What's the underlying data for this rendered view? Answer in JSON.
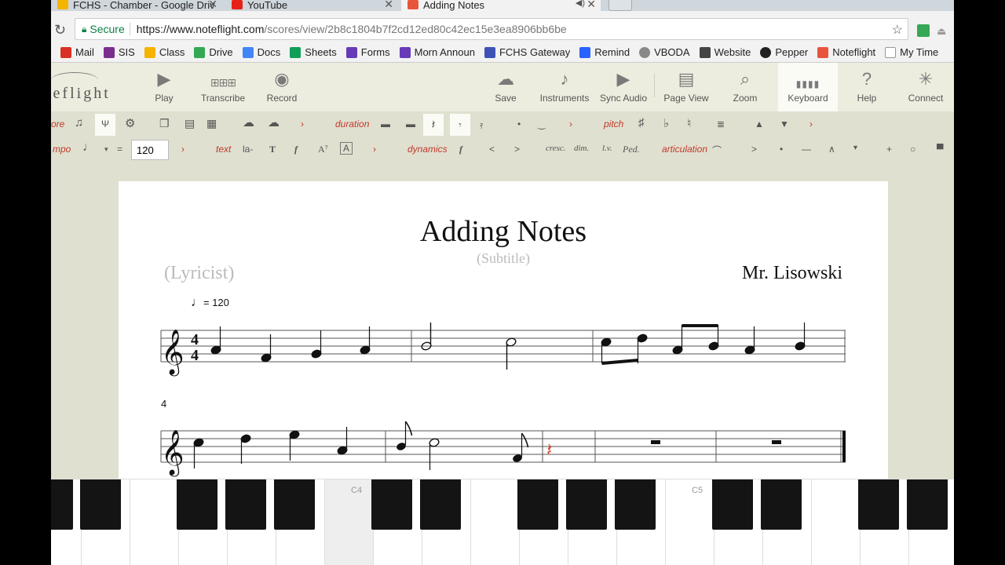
{
  "tabs": [
    {
      "title": "FCHS - Chamber - Google Driv",
      "color": "#f4b400"
    },
    {
      "title": "YouTube",
      "color": "#e62117"
    },
    {
      "title": "Adding Notes",
      "color": "#e8553d"
    }
  ],
  "omnibox": {
    "secure_label": "Secure",
    "url_host": "https://www.noteflight.com",
    "url_path": "/scores/view/2b8c1804b7f2cd12ed80c42ec15e3ea8906bb6be"
  },
  "bookmarks": [
    {
      "label": "Mail",
      "color": "#d93025"
    },
    {
      "label": "SIS",
      "color": "#7b2d8e"
    },
    {
      "label": "Class",
      "color": "#f4b400"
    },
    {
      "label": "Drive",
      "color": "#34a853"
    },
    {
      "label": "Docs",
      "color": "#4285f4"
    },
    {
      "label": "Sheets",
      "color": "#0f9d58"
    },
    {
      "label": "Forms",
      "color": "#673ab7"
    },
    {
      "label": "Morn Announ",
      "color": "#673ab7"
    },
    {
      "label": "FCHS Gateway",
      "color": "#3f51b5"
    },
    {
      "label": "Remind",
      "color": "#2962ff"
    },
    {
      "label": "VBODA",
      "color": "#888888"
    },
    {
      "label": "Website",
      "color": "#444444"
    },
    {
      "label": "Pepper",
      "color": "#222222"
    },
    {
      "label": "Noteflight",
      "color": "#e8553d"
    },
    {
      "label": "My Time",
      "color": "#aaaaaa"
    }
  ],
  "app": {
    "logo": "teflight",
    "toolbar": {
      "play": "Play",
      "transcribe": "Transcribe",
      "record": "Record",
      "save": "Save",
      "instruments": "Instruments",
      "sync_audio": "Sync Audio",
      "page_view": "Page View",
      "zoom": "Zoom",
      "keyboard": "Keyboard",
      "help": "Help",
      "connect": "Connect"
    },
    "palette": {
      "score_label": "ore",
      "duration_label": "duration",
      "pitch_label": "pitch",
      "tempo_label": "mpo",
      "tempo_value": "120",
      "text_label": "text",
      "lyric_btn": "la-",
      "dynamics_label": "dynamics",
      "dynamic_f": "f",
      "cresc": "cresc.",
      "dim": "dim.",
      "lv": "l.v.",
      "ped": "Ped.",
      "articulation_label": "articulation"
    }
  },
  "score": {
    "title": "Adding Notes",
    "subtitle": "(Subtitle)",
    "lyricist": "(Lyricist)",
    "composer": "Mr. Lisowski",
    "tempo_mark": "= 120",
    "time_signature": "4/4",
    "system2_measure": "4"
  },
  "keyboard": {
    "labels": [
      "C4",
      "C5"
    ]
  }
}
